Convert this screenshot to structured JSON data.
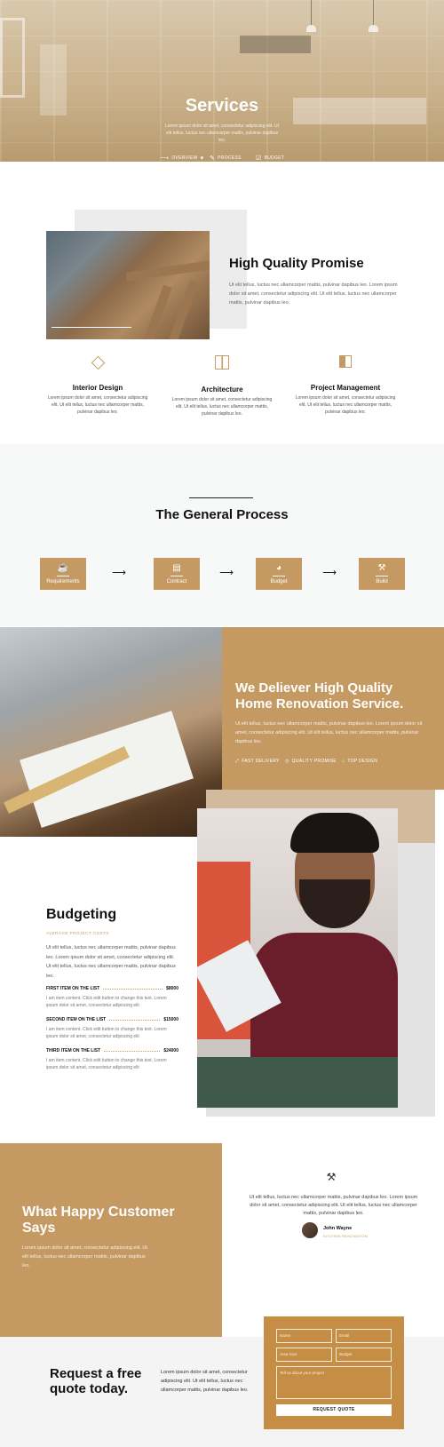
{
  "hero": {
    "title": "Services",
    "text": "Lorem ipsum dolor sit amet, consectetur adipiscing elit. Ut elit tellus, luctus nec ullamcorper mattis, pulvinar dapibus leo.",
    "links": [
      {
        "label": "OVERVIEW",
        "icon": "arrow-right-icon"
      },
      {
        "label": "PROCESS",
        "icon": "tools-icon"
      },
      {
        "label": "BUDGET",
        "icon": "budget-icon"
      }
    ]
  },
  "promise": {
    "title": "High Quality Promise",
    "text": "Ut elit tellus, luctus nec ullamcorper mattis, pulvinar dapibus leo. Lorem ipsum dolor sit amet, consectetur adipiscing elit. Ut elit tellus, luctus nec ullamcorper mattis, pulvinar dapibus leo."
  },
  "features": [
    {
      "title": "Interior Design",
      "text": "Lorem ipsum dolor sit amet, consectetur adipiscing elit. Ut elit tellus, luctus nec ullamcorper mattis, pulvinar dapibus leo.",
      "icon": "diamond-icon"
    },
    {
      "title": "Architecture",
      "text": "Lorem ipsum dolor sit amet, consectetur adipiscing elit. Ut elit tellus, luctus nec ullamcorper mattis, pulvinar dapibus leo.",
      "icon": "book-icon"
    },
    {
      "title": "Project Management",
      "text": "Lorem ipsum dolor sit amet, consectetur adipiscing elit. Ut elit tellus, luctus nec ullamcorper mattis, pulvinar dapibus leo.",
      "icon": "layout-icon"
    }
  ],
  "process": {
    "title": "The General Process",
    "steps": [
      {
        "label": "Requirements",
        "icon": "cup-icon"
      },
      {
        "label": "Contract",
        "icon": "document-icon"
      },
      {
        "label": "Budget",
        "icon": "pie-chart-icon"
      },
      {
        "label": "Build",
        "icon": "hammer-icon"
      }
    ],
    "arrow": "⟶"
  },
  "deliver": {
    "title": "We Deliever High Quality Home Renovation Service.",
    "text": "Ut elit tellus, luctus nec ullamcorper mattis, pulvinar dapibus leo. Lorem ipsum dolor sit amet, consectetur adipiscing elit. Ut elit tellus, luctus nec ullamcorper mattis, pulvinar dapibus leo.",
    "badges": [
      {
        "label": "FAST DELIVERY",
        "icon": "expand-icon"
      },
      {
        "label": "QUALITY PROMISE",
        "icon": "clock-icon"
      },
      {
        "label": "TOP DESIGN",
        "icon": "home-icon"
      }
    ]
  },
  "budget": {
    "title": "Budgeting",
    "subtitle": "AVERAGE PROJECT COSTS",
    "text": "Ut elit tellus, luctus nec ullamcorper mattis, pulvinar dapibus leo. Lorem ipsum dolor sit amet, consectetur adipiscing elit. Ut elit tellus, luctus nec ullamcorper mattis, pulvinar dapibus leo.",
    "items": [
      {
        "name": "FIRST ITEM ON THE LIST",
        "price": "$8000",
        "desc": "I am item content. Click edit button to change this text. Lorem ipsum dolor sit amet, consectetur adipiscing elit"
      },
      {
        "name": "SECOND ITEM ON THE LIST",
        "price": "$15000",
        "desc": "I am item content. Click edit button to change this text. Lorem ipsum dolor sit amet, consectetur adipiscing elit"
      },
      {
        "name": "THIRD ITEM ON THE LIST",
        "price": "$24000",
        "desc": "I am item content. Click edit button to change this text. Lorem ipsum dolor sit amet, consectetur adipiscing elit"
      }
    ]
  },
  "testimonial": {
    "title": "What Happy Customer Says",
    "text": "Lorem ipsum dolor sit amet, consectetur adipiscing elit. Ut elit tellus, luctus nec ullamcorper mattis, pulvinar dapibus leo.",
    "quote_icon": "hammer-icon",
    "quote": "Ut elit tellus, luctus nec ullamcorper mattis, pulvinar dapibus leo. Lorem ipsum dolor sit amet, consectetur adipiscing elit. Ut elit tellus, luctus nec ullamcorper mattis, pulvinar dapibus leo.",
    "author": "John Wayne",
    "role": "KITCHEN RENOVATION"
  },
  "request": {
    "title": "Request a free quote today.",
    "text": "Lorem ipsum dolor sit amet, consectetur adipiscing elit. Ut elit tellus, luctus nec ullamcorper mattis, pulvinar dapibus leo.",
    "form": {
      "name_placeholder": "Name",
      "email_placeholder": "Email",
      "area_placeholder": "Area Size",
      "budget_placeholder": "Budget",
      "message_placeholder": "Tell us about your project",
      "submit": "REQUEST QUOTE"
    }
  },
  "colors": {
    "accent": "#c49a62",
    "form": "#c68e45",
    "dark": "#111111"
  }
}
